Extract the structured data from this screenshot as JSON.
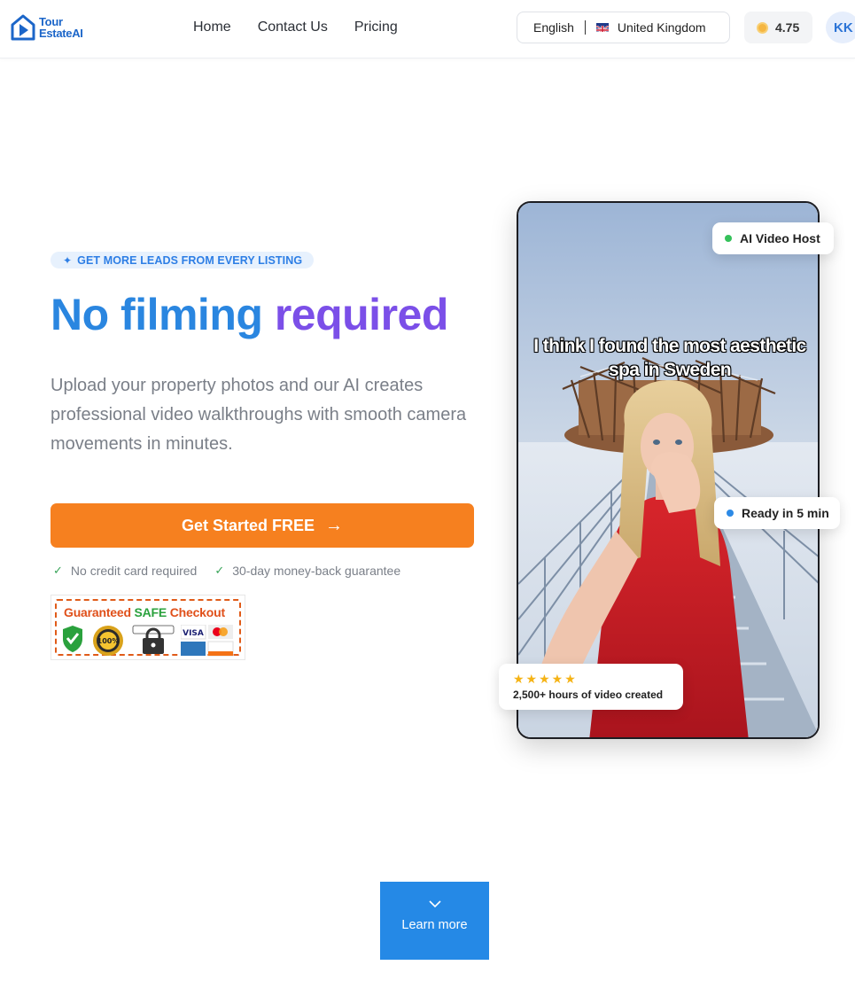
{
  "header": {
    "logo_line1": "Tour",
    "logo_line2": "EstateAI",
    "nav": [
      "Home",
      "Contact Us",
      "Pricing"
    ],
    "language": "English",
    "region": "United Kingdom",
    "credits": "4.75",
    "avatar_initials": "KK"
  },
  "hero": {
    "badge": "GET MORE LEADS FROM EVERY LISTING",
    "headline_part1": "No filming",
    "headline_part2": "required",
    "subtitle": "Upload your property photos and our AI creates professional video walkthroughs with smooth camera movements in minutes.",
    "cta_label": "Get Started FREE",
    "checks": [
      "No credit card required",
      "30-day money-back guarantee"
    ],
    "safe_checkout": {
      "title_pre": "Guaranteed ",
      "title_highlight": "SAFE",
      "title_post": " Checkout"
    }
  },
  "video": {
    "caption": "I think I found the most aesthetic spa in Sweden",
    "chip_ai": "AI Video Host",
    "chip_ready": "Ready in 5 min",
    "rating_stars": 5,
    "rating_text": "2,500+ hours of video created"
  },
  "learn_more": "Learn more",
  "colors": {
    "brand_blue": "#2a86e0",
    "brand_purple": "#7b4fe8",
    "cta_orange": "#f6801f",
    "learn_blue": "#2589e6"
  }
}
